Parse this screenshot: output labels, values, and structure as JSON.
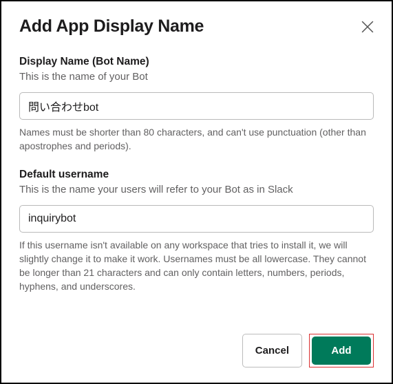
{
  "header": {
    "title": "Add App Display Name"
  },
  "displayName": {
    "label": "Display Name (Bot Name)",
    "description": "This is the name of your Bot",
    "value": "問い合わせbot",
    "help": "Names must be shorter than 80 characters, and can't use punctuation (other than apostrophes and periods)."
  },
  "defaultUsername": {
    "label": "Default username",
    "description": "This is the name your users will refer to your Bot as in Slack",
    "value": "inquirybot",
    "help": "If this username isn't available on any workspace that tries to install it, we will slightly change it to make it work. Usernames must be all lowercase. They cannot be longer than 21 characters and can only contain letters, numbers, periods, hyphens, and underscores."
  },
  "footer": {
    "cancel": "Cancel",
    "add": "Add"
  }
}
